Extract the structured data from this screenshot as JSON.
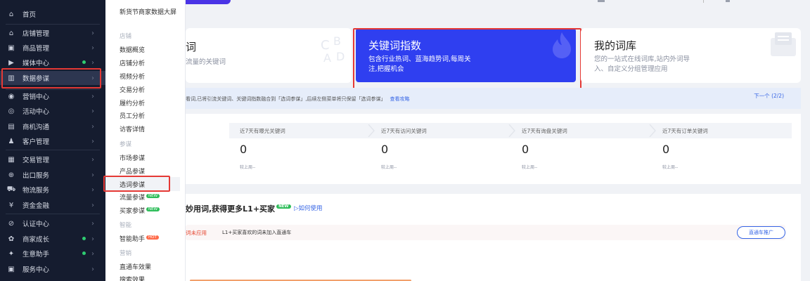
{
  "sidebar": {
    "items": [
      {
        "label": "首页",
        "icon": "home-icon",
        "glyph": "⌂"
      },
      {
        "label": "店铺管理",
        "icon": "store-icon",
        "glyph": "⌂"
      },
      {
        "label": "商品管理",
        "icon": "goods-icon",
        "glyph": "▣"
      },
      {
        "label": "媒体中心",
        "icon": "media-icon",
        "glyph": "▶"
      },
      {
        "label": "数据参谋",
        "icon": "chart-icon",
        "glyph": "▥"
      },
      {
        "label": "营销中心",
        "icon": "marketing-icon",
        "glyph": "◉"
      },
      {
        "label": "活动中心",
        "icon": "activity-icon",
        "glyph": "◎"
      },
      {
        "label": "商机沟通",
        "icon": "message-icon",
        "glyph": "▤"
      },
      {
        "label": "客户管理",
        "icon": "customer-icon",
        "glyph": "♟"
      },
      {
        "label": "交易管理",
        "icon": "trade-icon",
        "glyph": "▦"
      },
      {
        "label": "出口服务",
        "icon": "export-icon",
        "glyph": "⊕"
      },
      {
        "label": "物流服务",
        "icon": "logistics-icon",
        "glyph": "⛟"
      },
      {
        "label": "资金金融",
        "icon": "finance-icon",
        "glyph": "¥"
      },
      {
        "label": "认证中心",
        "icon": "certify-icon",
        "glyph": "⊘"
      },
      {
        "label": "商家成长",
        "icon": "growth-icon",
        "glyph": "✿"
      },
      {
        "label": "生意助手",
        "icon": "assistant-icon",
        "glyph": "✦"
      },
      {
        "label": "服务中心",
        "icon": "service-icon",
        "glyph": "▣"
      }
    ]
  },
  "submenu": {
    "big_screen": "新货节商家数据大屏",
    "group_store": "店铺",
    "store_items": [
      "数据概览",
      "店铺分析",
      "视频分析",
      "交易分析",
      "履约分析",
      "员工分析",
      "访客详情"
    ],
    "group_staff": "参谋",
    "staff_items": [
      "市场参谋",
      "产品参谋",
      "选词参谋",
      "流量参谋",
      "买家参谋"
    ],
    "group_smart": "智能",
    "smart_items": [
      "智能助手"
    ],
    "group_marketing": "营销",
    "marketing_items": [
      "直通车效果",
      "搜索效果"
    ],
    "tag_new": "NEW",
    "tag_hot": "HOT"
  },
  "cards": {
    "first": {
      "title": "词",
      "desc": "流量的关键词"
    },
    "keyword_index": {
      "title": "关键词指数",
      "desc": "包含行业热词、蓝海趋势词,每周关注,把握机会"
    },
    "my_lexicon": {
      "title": "我的词库",
      "desc": "您的一站式在线词库,站内外词导入、自定义分组管理应用"
    }
  },
  "notice": {
    "text": "看词,已将引流关键词、关键词指数融合到「选词参谋」,后续左侧菜单将只保留「选词参谋」",
    "link": "查看攻略",
    "next": "下一个 (2/2)"
  },
  "stats": [
    {
      "label": "近7天有曝光关键词",
      "value": "0",
      "compare": "较上周--"
    },
    {
      "label": "近7天有访问关键词",
      "value": "0",
      "compare": "较上周--"
    },
    {
      "label": "近7天有询盘关键词",
      "value": "0",
      "compare": "较上周--"
    },
    {
      "label": "近7天有订单关键词",
      "value": "0",
      "compare": "较上周--"
    }
  ],
  "bottom": {
    "title": "妙用词,获得更多L1+买家",
    "how_to_use": "如何使用",
    "apply": "词未应用",
    "desc": "L1+买家喜欢的词未加入直通车",
    "button": "直通车推广"
  },
  "colors": {
    "sidebar_bg": "#151c2f",
    "accent_blue": "#2f3ff0",
    "highlight_red": "#e53935",
    "link_blue": "#3564e5",
    "status_green": "#2ecc71"
  }
}
